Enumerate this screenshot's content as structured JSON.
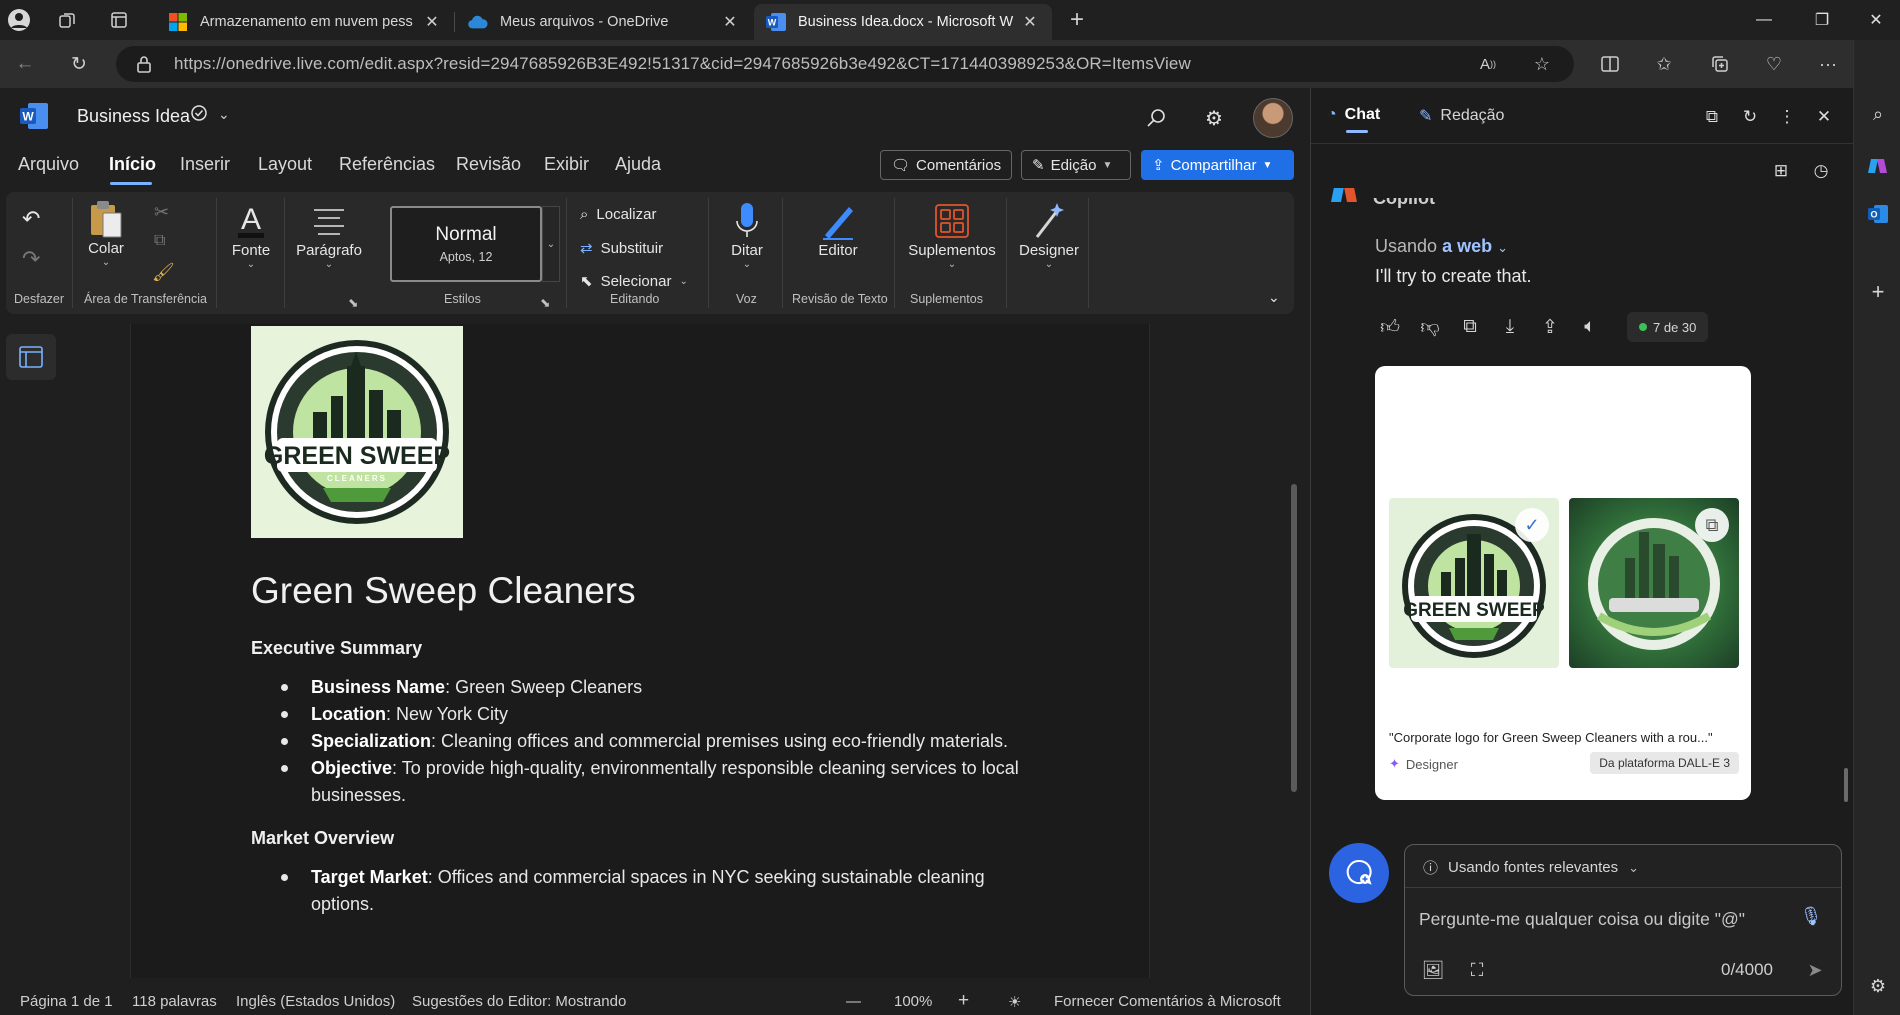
{
  "browser": {
    "tabs": [
      {
        "title": "Armazenamento em nuvem pess",
        "icon": "microsoft-icon"
      },
      {
        "title": "Meus arquivos - OneDrive",
        "icon": "onedrive-icon"
      },
      {
        "title": "Business Idea.docx - Microsoft W",
        "icon": "word-icon",
        "active": true
      }
    ],
    "url": "https://onedrive.live.com/edit.aspx?resid=2947685926B3E492!51317&cid=2947685926b3e492&CT=1714403989253&OR=ItemsView"
  },
  "word": {
    "doc_name": "Business Idea",
    "menu": [
      "Arquivo",
      "Início",
      "Inserir",
      "Layout",
      "Referências",
      "Revisão",
      "Exibir",
      "Ajuda"
    ],
    "buttons": {
      "comments": "Comentários",
      "editing": "Edição",
      "share": "Compartilhar"
    },
    "ribbon": {
      "undo_label": "Desfazer",
      "paste": "Colar",
      "clipboard_label": "Área de Transferência",
      "font": "Fonte",
      "paragraph": "Parágrafo",
      "style_name": "Normal",
      "style_font": "Aptos, 12",
      "styles_label": "Estilos",
      "find": "Localizar",
      "replace": "Substituir",
      "select": "Selecionar",
      "editing_label": "Editando",
      "dictate": "Ditar",
      "voice_label": "Voz",
      "editor": "Editor",
      "text_review_label": "Revisão de Texto",
      "addins": "Suplementos",
      "addins_label": "Suplementos",
      "designer": "Designer"
    },
    "document": {
      "title": "Green Sweep Cleaners",
      "sections": [
        {
          "heading": "Executive Summary",
          "items": [
            {
              "label": "Business Name",
              "text": ": Green Sweep Cleaners"
            },
            {
              "label": "Location",
              "text": ": New York City"
            },
            {
              "label": "Specialization",
              "text": ": Cleaning offices and commercial premises using eco-friendly materials."
            },
            {
              "label": "Objective",
              "text": ": To provide high-quality, environmentally responsible cleaning services to local businesses."
            }
          ]
        },
        {
          "heading": "Market Overview",
          "items": [
            {
              "label": "Target Market",
              "text": ": Offices and commercial spaces in NYC seeking sustainable cleaning options."
            }
          ]
        }
      ],
      "logo_text": "GREEN SWEEP",
      "logo_subtext": "CLEANERS"
    },
    "status": {
      "page": "Página 1 de 1",
      "words": "118 palavras",
      "language": "Inglês (Estados Unidos)",
      "editor_suggestions": "Sugestões do Editor: Mostrando",
      "zoom": "100%",
      "feedback": "Fornecer Comentários à Microsoft"
    }
  },
  "copilot": {
    "tabs": {
      "chat": "Chat",
      "compose": "Redação"
    },
    "name": "Copilot",
    "using_prefix": "Usando",
    "using_source": "a web",
    "message": "I'll try to create that.",
    "count": "7 de 30",
    "card": {
      "caption": "\"Corporate logo for Green Sweep Cleaners with a rou...\"",
      "designer": "Designer",
      "source": "Da plataforma DALL-E 3"
    },
    "compose": {
      "mode": "Usando fontes relevantes",
      "placeholder": "Pergunte-me qualquer coisa ou digite \"@\"",
      "counter": "0/4000"
    }
  },
  "colors": {
    "accent": "#1f6fe6",
    "copilot_button": "#2b63e0",
    "logo_green": "#4f9a3a"
  }
}
